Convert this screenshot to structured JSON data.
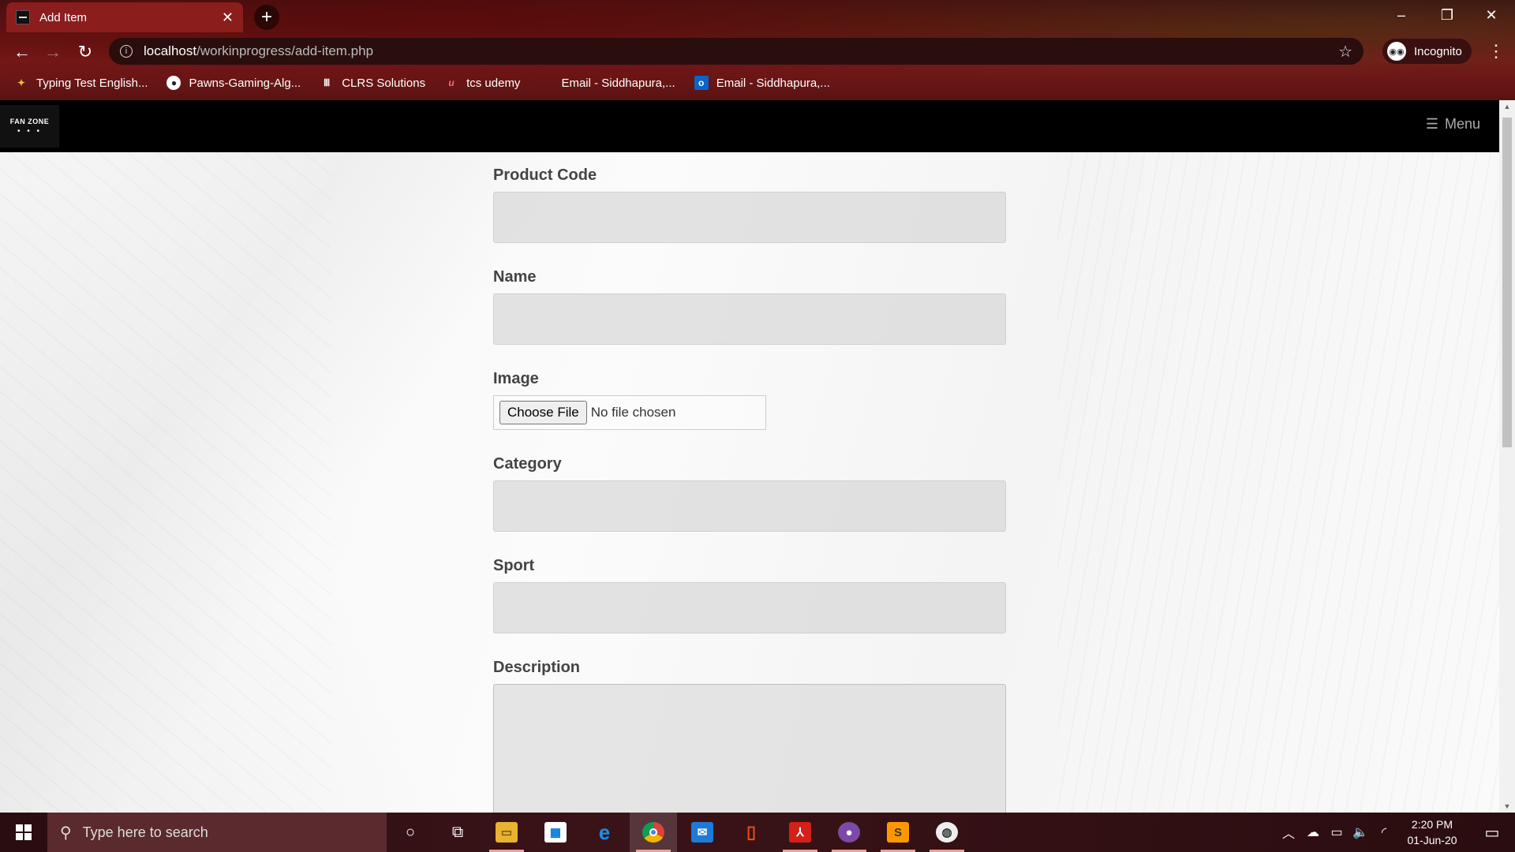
{
  "browser": {
    "tab_title": "Add Item",
    "tab_close": "✕",
    "new_tab": "+",
    "url_host": "localhost",
    "url_path": "/workinprogress/add-item.php",
    "profile_label": "Incognito",
    "bookmarks": [
      {
        "label": "Typing Test English...",
        "icon": "typing-test-icon"
      },
      {
        "label": "Pawns-Gaming-Alg...",
        "icon": "github-icon"
      },
      {
        "label": "CLRS Solutions",
        "icon": "clrs-icon"
      },
      {
        "label": "tcs udemy",
        "icon": "udemy-icon"
      },
      {
        "label": "Email - Siddhapura,...",
        "icon": "microsoft-icon"
      },
      {
        "label": "Email - Siddhapura,...",
        "icon": "outlook-icon"
      }
    ]
  },
  "site": {
    "logo_text": "FAN ZONE",
    "logo_dots": "• • •",
    "menu_label": "Menu"
  },
  "form": {
    "product_code_label": "Product Code",
    "name_label": "Name",
    "image_label": "Image",
    "choose_file_label": "Choose File",
    "file_status": "No file chosen",
    "category_label": "Category",
    "sport_label": "Sport",
    "description_label": "Description"
  },
  "taskbar": {
    "search_placeholder": "Type here to search",
    "time": "2:20 PM",
    "date": "01-Jun-20"
  },
  "colors": {
    "chrome_accent": "#8b1d1d",
    "site_nav": "#000000",
    "field_bg": "#d7d7d7",
    "label": "#444444"
  }
}
